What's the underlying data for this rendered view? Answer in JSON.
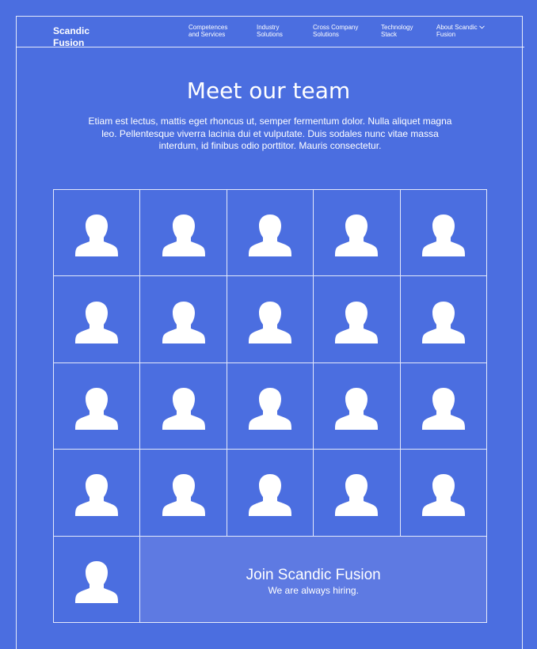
{
  "header": {
    "logo": "Scandic Fusion",
    "nav": [
      {
        "label": "Competences\nand Services",
        "dropdown": false
      },
      {
        "label": "Industry\nSolutions",
        "dropdown": false
      },
      {
        "label": "Cross Company\nSolutions",
        "dropdown": false
      },
      {
        "label": "Technology\nStack",
        "dropdown": false
      },
      {
        "label": "About Scandic\nFusion",
        "dropdown": true
      }
    ],
    "dropdown_icon": "chevron-down-icon"
  },
  "main": {
    "title": "Meet our team",
    "intro": "Etiam est lectus, mattis eget rhoncus ut, semper fermentum dolor. Nulla aliquet magna leo. Pellentesque viverra lacinia dui et vulputate. Duis sodales nunc vitae massa interdum, id finibus odio porttitor. Mauris consectetur.",
    "team": {
      "member_count": 21,
      "avatar_icon": "person-silhouette-icon"
    },
    "join": {
      "title": "Join Scandic Fusion",
      "subtitle": "We are always hiring."
    }
  },
  "colors": {
    "background": "#4b6ee0",
    "join_background": "#5e7ae2",
    "text": "#ffffff",
    "lines": "#ffffff"
  }
}
